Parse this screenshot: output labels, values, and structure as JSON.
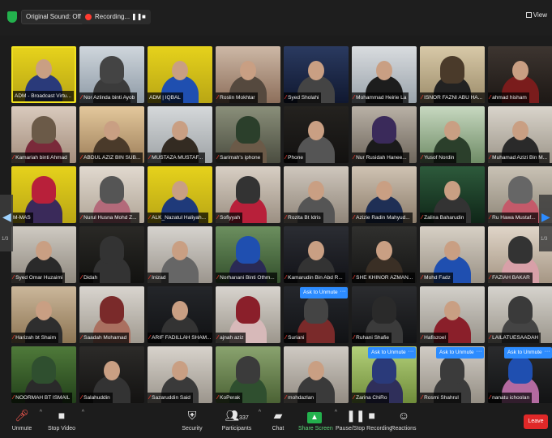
{
  "topbar": {
    "sound_label": "Original Sound: Off",
    "recording_label": "Recording...",
    "pause_icon": "pause-icon",
    "stop_icon": "stop-icon",
    "view_label": "View"
  },
  "pager": {
    "page_label_left": "1/3",
    "page_label_right": "1/3"
  },
  "tiles": [
    {
      "name": "ADM - Broadcast Virtu...",
      "muted": false
    },
    {
      "name": "Nor Azlinda binti Ayob",
      "muted": true
    },
    {
      "name": "ADM | IQBAL",
      "muted": false
    },
    {
      "name": "Roslin Mokhtar",
      "muted": true
    },
    {
      "name": "Syed Sholahi",
      "muted": true
    },
    {
      "name": "Mohammad Heirie La",
      "muted": true
    },
    {
      "name": "ISNOR FAZNI ABU HA...",
      "muted": true
    },
    {
      "name": "ahmad hisham",
      "muted": true
    },
    {
      "name": "Kamariah binti Ahmad",
      "muted": true
    },
    {
      "name": "ABDUL AZIZ BIN SUB...",
      "muted": true
    },
    {
      "name": "MUSTAZA MUSTAF...",
      "muted": true
    },
    {
      "name": "Sarimah's iphone",
      "muted": true
    },
    {
      "name": "Phone",
      "muted": true
    },
    {
      "name": "Nur Rusidah Hanee...",
      "muted": true
    },
    {
      "name": "Yusof Nordin",
      "muted": true
    },
    {
      "name": "Muhamad Azizi Bin M...",
      "muted": true
    },
    {
      "name": "M-MAS",
      "muted": false
    },
    {
      "name": "Nurul Husna Mohd Z...",
      "muted": true
    },
    {
      "name": "ALK_Nazatul Haliyah...",
      "muted": true
    },
    {
      "name": "Sofiyyah",
      "muted": true
    },
    {
      "name": "Rozita Bt Idris",
      "muted": true
    },
    {
      "name": "Azizie Radin Mahyud...",
      "muted": true
    },
    {
      "name": "Zalina Baharudin",
      "muted": true
    },
    {
      "name": "Ru Hawa Mustaf...",
      "muted": true
    },
    {
      "name": "Syed Omar Huzaimi",
      "muted": true
    },
    {
      "name": "Didah",
      "muted": true
    },
    {
      "name": "Inizad",
      "muted": true
    },
    {
      "name": "Norhanani Binti Othm...",
      "muted": true
    },
    {
      "name": "Kamarudin Bin Abd R...",
      "muted": true
    },
    {
      "name": "SHE KHINOR AZMAN...",
      "muted": true
    },
    {
      "name": "Mohd Fadz",
      "muted": true
    },
    {
      "name": "FAZIAH BAKAR",
      "muted": true
    },
    {
      "name": "Harizah bt Shaim",
      "muted": true
    },
    {
      "name": "Saadah Mohamad",
      "muted": true
    },
    {
      "name": "ARIF FADILLAH SHAM...",
      "muted": true
    },
    {
      "name": "ajnah aziz",
      "muted": true
    },
    {
      "name": "Suriani",
      "muted": true,
      "ask_unmute": "Ask to Unmute"
    },
    {
      "name": "Ruhani Shafie",
      "muted": true
    },
    {
      "name": "Hafiszoel",
      "muted": true
    },
    {
      "name": "LAILATUESAADAH",
      "muted": true
    },
    {
      "name": "NOORMAH BT ISMAIL",
      "muted": true
    },
    {
      "name": "Salahuddin",
      "muted": true
    },
    {
      "name": "Sazaruddin Said",
      "muted": true
    },
    {
      "name": "KoPerak",
      "muted": true
    },
    {
      "name": "mohdazlan",
      "muted": true
    },
    {
      "name": "Zarina ChiRo",
      "muted": true,
      "ask_unmute": "Ask to Unmute"
    },
    {
      "name": "Rosmi Shahrul",
      "muted": true,
      "ask_unmute": "Ask to Unmute"
    },
    {
      "name": "nanatu ichoolan",
      "muted": true,
      "ask_unmute": "Ask to Unmute"
    }
  ],
  "toolbar": {
    "unmute": "Unmute",
    "stop_video": "Stop Video",
    "security": "Security",
    "participants": "Participants",
    "participants_count": "337",
    "chat": "Chat",
    "share_screen": "Share Screen",
    "pause_stop_recording": "Pause/Stop Recording",
    "reactions": "Reactions",
    "leave": "Leave"
  },
  "colors": {
    "banner_yellow": "#e8d214",
    "mute_red": "#ff3b30",
    "zoom_blue": "#2d8cff",
    "share_green": "#23b14d",
    "leave_red": "#e02828"
  }
}
